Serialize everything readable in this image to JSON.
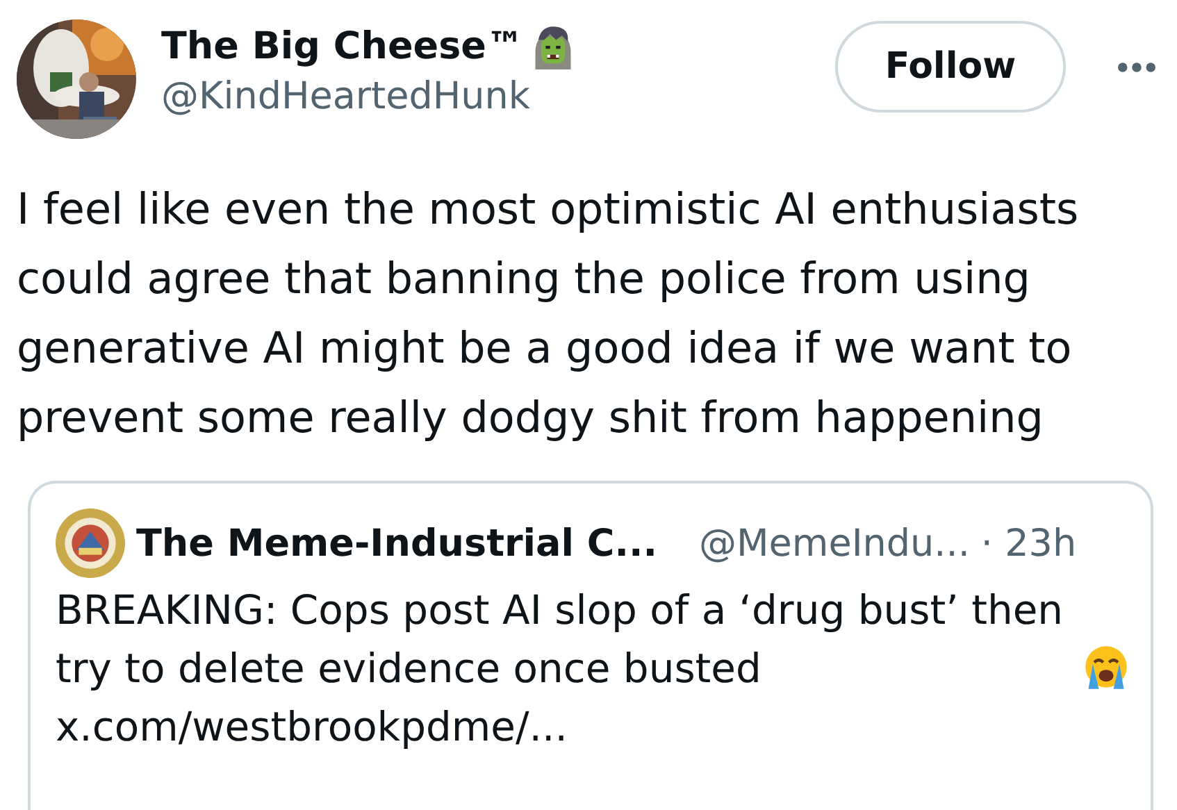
{
  "author": {
    "name": "The Big Cheese™",
    "handle": "@KindHeartedHunk"
  },
  "follow_button": "Follow",
  "text": "I feel like even the most optimistic AI enthusiasts could agree that banning the police from using generative AI might be a good idea if we want to prevent some really dodgy shit from happening",
  "quoted": {
    "name": "The Meme-Industrial C...",
    "handle": "@MemeIndu...",
    "time": "· 23h",
    "text": "BREAKING: Cops post AI slop of a ‘drug bust’ then try to delete evidence once busted",
    "link": "x.com/westbrookpdme/..."
  }
}
